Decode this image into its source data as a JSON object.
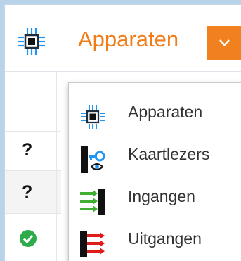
{
  "header": {
    "title": "Apparaten",
    "icon": "chip-icon",
    "accent_color": "#f07d1a"
  },
  "dropdown": {
    "icon": "chevron-down-icon"
  },
  "table": {
    "rows": [
      {
        "status": ""
      },
      {
        "status": "?"
      },
      {
        "status": "?"
      },
      {
        "status": "ok-check-icon"
      }
    ]
  },
  "menu": {
    "items": [
      {
        "label": "Apparaten",
        "icon": "chip-icon"
      },
      {
        "label": "Kaartlezers",
        "icon": "card-reader-key-icon"
      },
      {
        "label": "Ingangen",
        "icon": "inputs-arrow-icon"
      },
      {
        "label": "Uitgangen",
        "icon": "outputs-arrow-icon"
      }
    ]
  }
}
